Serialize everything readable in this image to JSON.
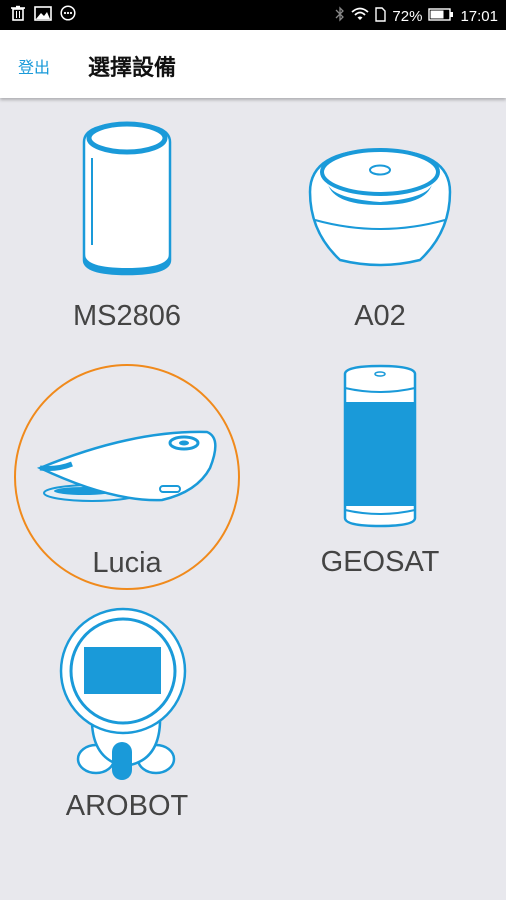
{
  "status_bar": {
    "battery_percent": "72%",
    "time": "17:01"
  },
  "header": {
    "logout_label": "登出",
    "title": "選擇設備"
  },
  "devices": [
    {
      "label": "MS2806",
      "selected": false
    },
    {
      "label": "A02",
      "selected": false
    },
    {
      "label": "Lucia",
      "selected": true
    },
    {
      "label": "GEOSAT",
      "selected": false
    },
    {
      "label": "AROBOT",
      "selected": false
    }
  ],
  "colors": {
    "accent_blue": "#1a9ad9",
    "selection_ring": "#f08a1c",
    "background": "#e8e8ed"
  }
}
